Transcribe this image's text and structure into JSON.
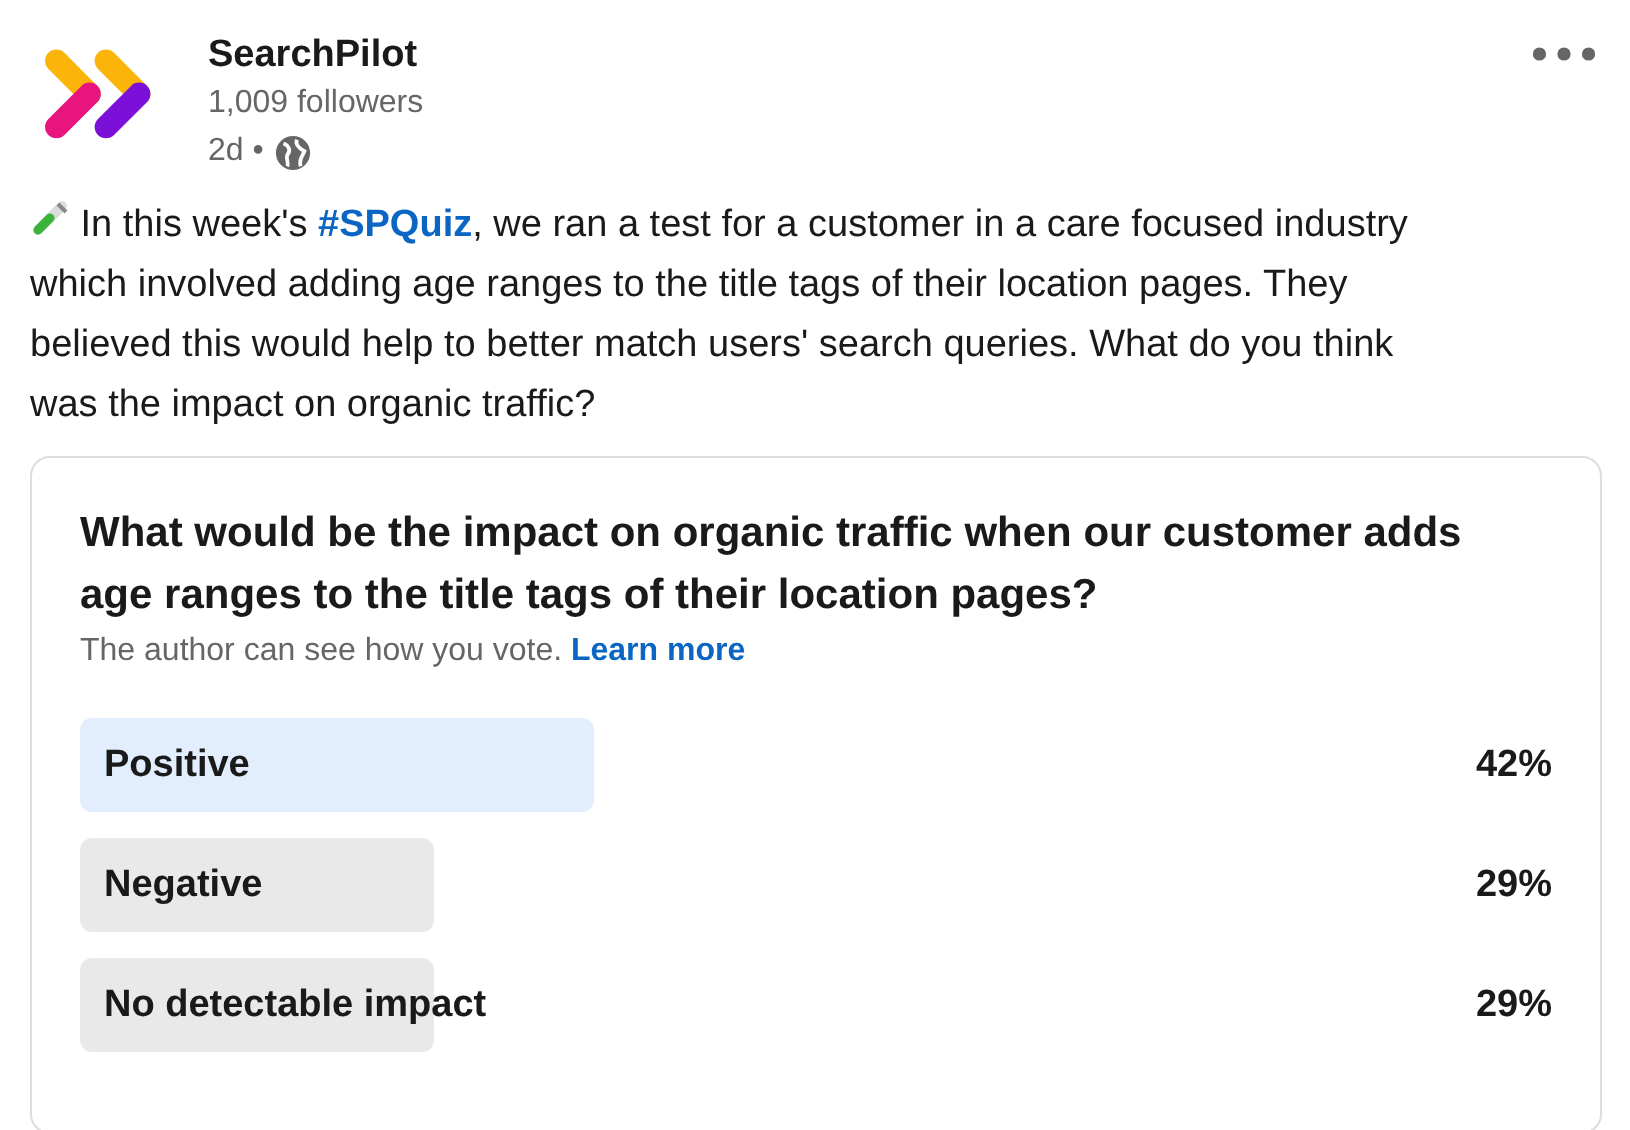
{
  "author": {
    "name": "SearchPilot",
    "followers": "1,009 followers",
    "time": "2d •"
  },
  "post": {
    "text_before": "In this week's ",
    "hashtag": "#SPQuiz",
    "text_after": ", we ran a test for a customer in a care focused industry which involved adding age ranges to the title tags of their location pages. They believed this would help to better match users' search queries. What do you think was the impact on organic traffic?"
  },
  "poll": {
    "question": "What would be the impact on organic traffic when our customer adds age ranges to the title tags of their location pages?",
    "note": "The author can see how you vote.",
    "note_link": "Learn more",
    "options": [
      {
        "label": "Positive",
        "percent": "42%",
        "selected": true
      },
      {
        "label": "Negative",
        "percent": "29%",
        "selected": false
      },
      {
        "label": "No detectable impact",
        "percent": "29%",
        "selected": false
      }
    ]
  }
}
